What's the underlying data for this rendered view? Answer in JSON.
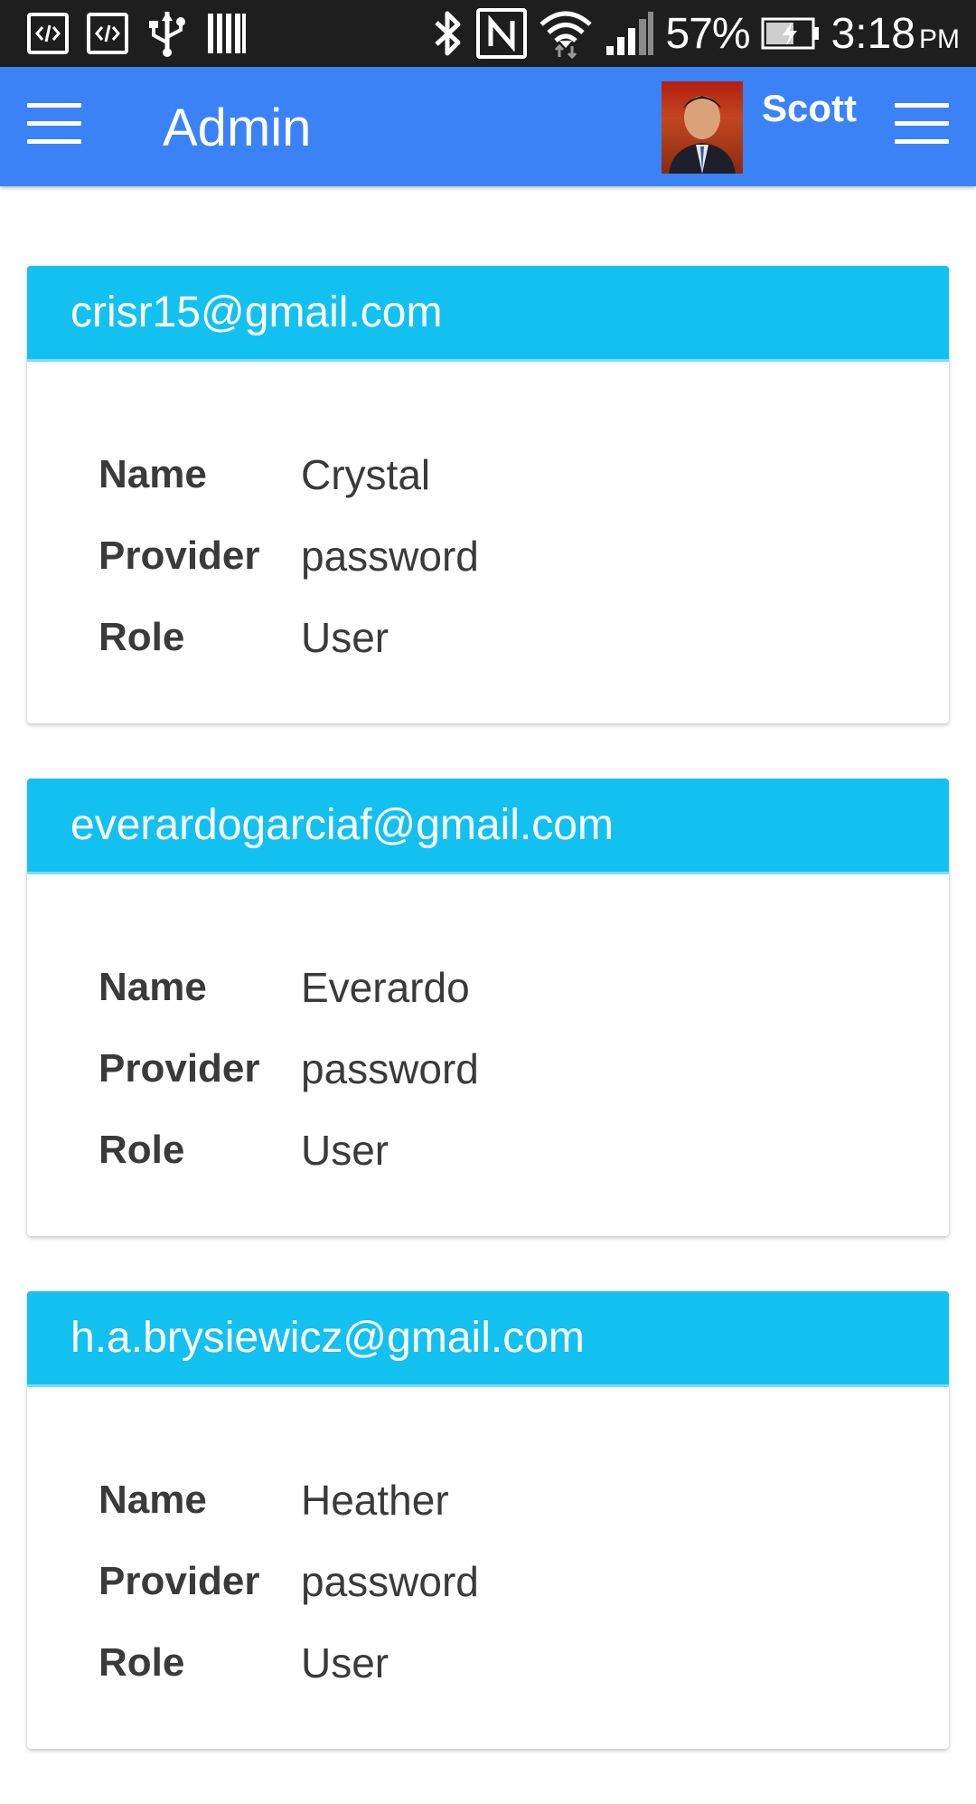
{
  "status_bar": {
    "battery_percent": "57%",
    "time": "3:18",
    "ampm": "PM",
    "icons": [
      "code-icon",
      "code-icon",
      "usb-icon",
      "barcode-icon",
      "bluetooth-icon",
      "nfc-icon",
      "wifi-icon",
      "signal-icon",
      "battery-icon"
    ]
  },
  "app_bar": {
    "title": "Admin",
    "user_name": "Scott",
    "color": "#3b82f6"
  },
  "labels": {
    "name": "Name",
    "provider": "Provider",
    "role": "Role"
  },
  "users": [
    {
      "email": "crisr15@gmail.com",
      "name": "Crystal",
      "provider": "password",
      "role": "User"
    },
    {
      "email": "everardogarciaf@gmail.com",
      "name": "Everardo",
      "provider": "password",
      "role": "User"
    },
    {
      "email": "h.a.brysiewicz@gmail.com",
      "name": "Heather",
      "provider": "password",
      "role": "User"
    }
  ],
  "colors": {
    "card_header": "#13c1f1",
    "text": "#3a3a3a"
  }
}
